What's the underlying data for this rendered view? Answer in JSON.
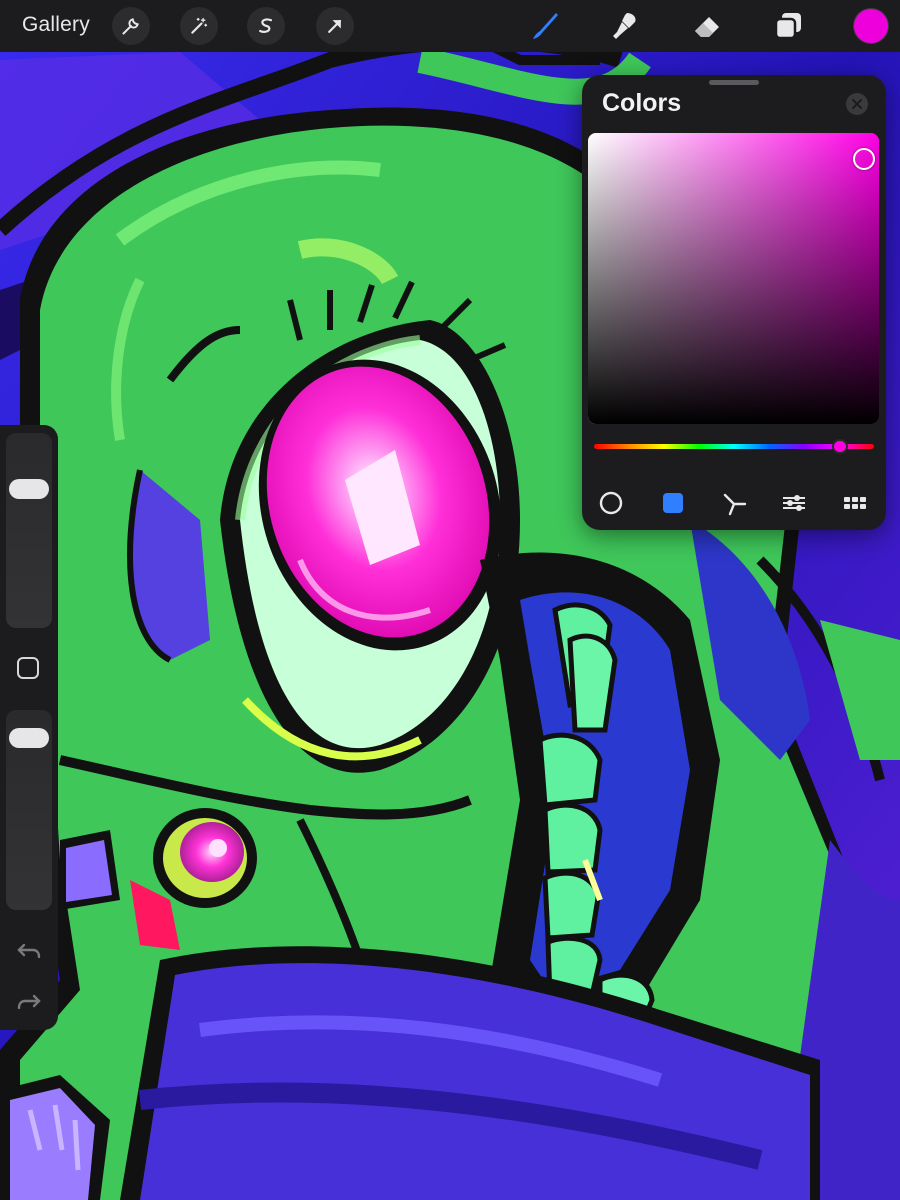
{
  "toolbar": {
    "gallery_label": "Gallery",
    "actions": [
      {
        "name": "actions-wrench-icon"
      },
      {
        "name": "adjustments-magic-wand-icon"
      },
      {
        "name": "selection-s-icon"
      },
      {
        "name": "transform-arrow-icon"
      }
    ],
    "tools": [
      {
        "name": "brush-icon",
        "active": true
      },
      {
        "name": "smudge-icon",
        "active": false
      },
      {
        "name": "eraser-icon",
        "active": false
      },
      {
        "name": "layers-icon",
        "active": false
      }
    ],
    "current_color": "#ee00dd",
    "active_tool_color": "#2f7fff"
  },
  "sidebar": {
    "size_slider_value": 0.75,
    "opacity_slider_value": 0.92,
    "icons": [
      "modify-square-icon",
      "undo-icon",
      "redo-icon"
    ]
  },
  "colors_panel": {
    "title": "Colors",
    "hue_color": "#ff00e6",
    "hue_position": 0.88,
    "saturation": 0.95,
    "brightness": 0.91,
    "modes": [
      {
        "name": "disc-mode-icon",
        "active": false
      },
      {
        "name": "classic-mode-icon",
        "active": true
      },
      {
        "name": "harmony-mode-icon",
        "active": false
      },
      {
        "name": "value-mode-icon",
        "active": false
      },
      {
        "name": "palettes-mode-icon",
        "active": false
      }
    ]
  }
}
